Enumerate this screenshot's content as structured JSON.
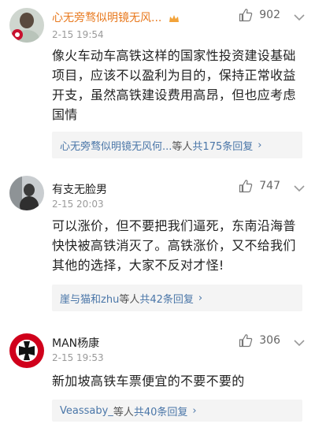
{
  "comments": [
    {
      "name": "心无旁骛似明镜无风...",
      "time": "2-15 19:54",
      "likes": "902",
      "text": "像火车动车高铁这样的国家性投资建设基础项目，应该不以盈利为目的，保持正常收益开支，虽然高铁建设费用高昂，但也应考虑国情",
      "reply_users": "心无旁骛似明镜无风何...",
      "reply_etc": "等人",
      "reply_count": "共175条回复",
      "reply_arrow": "›"
    },
    {
      "name": "有支无脸男",
      "time": "2-15 20:03",
      "likes": "747",
      "text": "可以涨价，但不要把我们逼死，东南沿海普快快被高铁消灭了。高铁涨价，又不给我们其他的选择，大家不反对才怪!",
      "reply_users": "崖与猫和zhu",
      "reply_etc": "等人",
      "reply_count": "共42条回复",
      "reply_arrow": "›"
    },
    {
      "name": "MAN杨康",
      "time": "2-15 19:53",
      "likes": "306",
      "text": "新加坡高铁车票便宜的不要不要的",
      "reply_users": "Veassaby_",
      "reply_etc": "等人",
      "reply_count": "共40条回复",
      "reply_arrow": "›"
    }
  ],
  "colors": {
    "vip_name": "#e8791e",
    "link": "#4a76a8",
    "time": "#9a9a9a"
  },
  "icons": {
    "like": "thumbs-up-icon",
    "more": "chevron-down-icon",
    "vip": "crown-icon"
  }
}
